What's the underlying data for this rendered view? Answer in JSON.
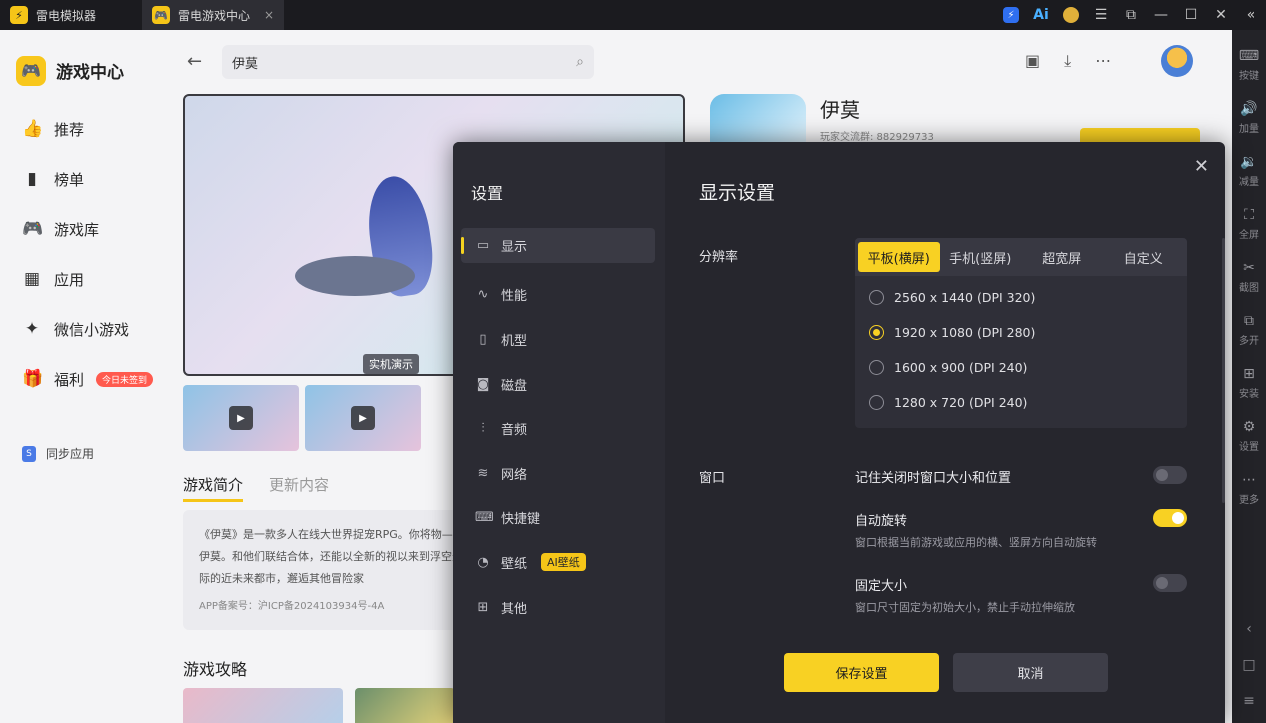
{
  "titlebar": {
    "tabs": [
      {
        "label": "雷电模拟器"
      },
      {
        "label": "雷电游戏中心"
      }
    ],
    "close_tab_glyph": "×",
    "ai_label": "Ai"
  },
  "right_toolbar": {
    "items": [
      {
        "label": "按键",
        "icon": "keyboard-icon"
      },
      {
        "label": "加量",
        "icon": "volume-up-icon"
      },
      {
        "label": "减量",
        "icon": "volume-down-icon"
      },
      {
        "label": "全屏",
        "icon": "fullscreen-icon"
      },
      {
        "label": "截图",
        "icon": "scissors-icon"
      },
      {
        "label": "多开",
        "icon": "multi-instance-icon"
      },
      {
        "label": "安装",
        "icon": "install-icon"
      },
      {
        "label": "设置",
        "icon": "gear-icon"
      },
      {
        "label": "更多",
        "icon": "more-icon"
      }
    ]
  },
  "sidebar": {
    "brand": "游戏中心",
    "items": [
      {
        "label": "推荐"
      },
      {
        "label": "榜单"
      },
      {
        "label": "游戏库"
      },
      {
        "label": "应用"
      },
      {
        "label": "微信小游戏"
      },
      {
        "label": "福利",
        "badge": "今日未签到"
      }
    ],
    "sync": "同步应用"
  },
  "header": {
    "search_value": "伊莫"
  },
  "game": {
    "name": "伊莫",
    "group": "玩家交流群: 882929733",
    "demo_label": "实机演示",
    "tabs": [
      "游戏简介",
      "更新内容"
    ],
    "intro": "《伊莫》是一款多人在线大世界捉宠RPG。你将物——伊莫。和他们联结合体，还能以全新的视以来到浮空天际的近未来都市，邂逅其他冒险家",
    "icp": "APP备案号：沪ICP备2024103934号-4A",
    "guides_title": "游戏攻略"
  },
  "dialog": {
    "title": "设置",
    "menu": [
      {
        "label": "显示",
        "icon": "monitor-icon"
      },
      {
        "label": "性能",
        "icon": "performance-icon"
      },
      {
        "label": "机型",
        "icon": "phone-icon"
      },
      {
        "label": "磁盘",
        "icon": "disk-icon"
      },
      {
        "label": "音频",
        "icon": "audio-icon"
      },
      {
        "label": "网络",
        "icon": "wifi-icon"
      },
      {
        "label": "快捷键",
        "icon": "keyboard-icon"
      },
      {
        "label": "壁纸",
        "icon": "palette-icon",
        "tag": "AI壁纸"
      },
      {
        "label": "其他",
        "icon": "grid-icon"
      }
    ],
    "section_title": "显示设置",
    "resolution": {
      "label": "分辨率",
      "tabs": [
        "平板(横屏)",
        "手机(竖屏)",
        "超宽屏",
        "自定义"
      ],
      "selected_tab": "平板(横屏)",
      "options": [
        "2560 x 1440  (DPI 320)",
        "1920 x 1080  (DPI 280)",
        "1600 x 900  (DPI 240)",
        "1280 x 720  (DPI 240)"
      ],
      "selected_option": "1920 x 1080  (DPI 280)"
    },
    "window": {
      "label": "窗口",
      "options": [
        {
          "title": "记住关闭时窗口大小和位置",
          "desc": "",
          "on": false
        },
        {
          "title": "自动旋转",
          "desc": "窗口根据当前游戏或应用的横、竖屏方向自动旋转",
          "on": true
        },
        {
          "title": "固定大小",
          "desc": "窗口尺寸固定为初始大小，禁止手动拉伸缩放",
          "on": false
        }
      ]
    },
    "save_label": "保存设置",
    "cancel_label": "取消"
  },
  "colors": {
    "accent": "#f8d123",
    "dialog_bg": "#26262d",
    "badge_red": "#ff5a4e"
  }
}
